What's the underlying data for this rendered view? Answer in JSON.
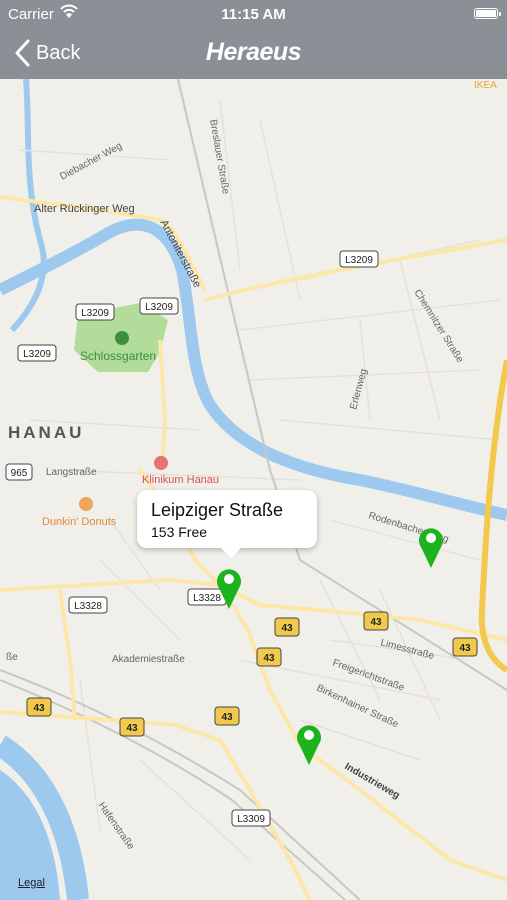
{
  "status_bar": {
    "carrier": "Carrier",
    "time": "11:15 AM"
  },
  "nav": {
    "back_label": "Back",
    "brand": "Heraeus"
  },
  "map": {
    "district": "HANAU",
    "places": {
      "schlossgarten": "Schlossgarten",
      "klinikum": "Klinikum Hanau",
      "dunkin": "Dunkin' Donuts",
      "ikea": "IKEA"
    },
    "streets": {
      "diebacher": "Diebacher Weg",
      "alter": "Alter Rückinger Weg",
      "antoniter": "Antoniterstraße",
      "breslauer": "Breslauer Straße",
      "chemnitzer": "Chemnitzer Straße",
      "erlenweg": "Erlenweg",
      "lang": "Langstraße",
      "rodenbacher": "Rodenbacher Weg",
      "limes": "Limesstraße",
      "freigericht": "Freigerichtstraße",
      "birkenhainer": "Birkenhainer Straße",
      "akademie": "Akademiestraße",
      "industrie": "Industrieweg",
      "hafen": "Hafenstraße",
      "edge_se": "ße"
    },
    "road_shields": {
      "l3209": "L3209",
      "l3328": "L3328",
      "l3309": "L3309",
      "r965": "965",
      "b43": "43"
    },
    "legal": "Legal"
  },
  "callout": {
    "title": "Leipziger Straße",
    "subtitle": "153 Free"
  },
  "colors": {
    "bar": "#8a9096",
    "pin": "#1db31d",
    "water": "#9dc9ee",
    "park": "#a6d88b"
  }
}
